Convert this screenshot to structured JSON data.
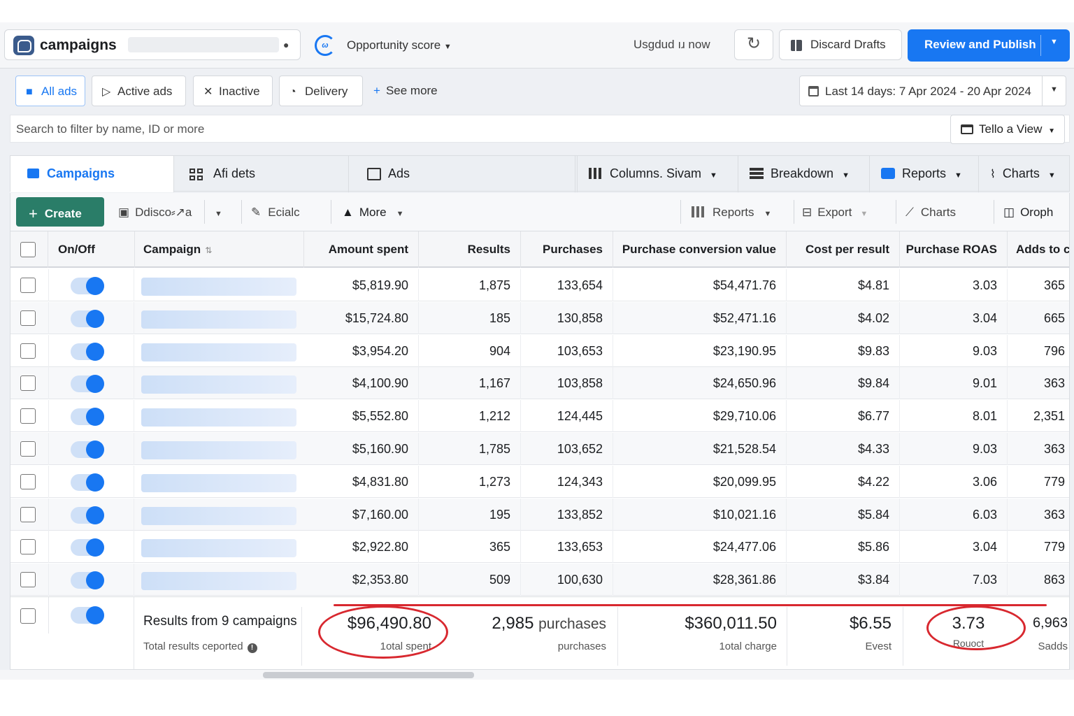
{
  "topbar": {
    "account_name": "campaigns",
    "opportunity_label": "Opportunity score",
    "opportunity_icon_text": "ω",
    "updated_text": "Usgdud ıɹ now",
    "discard_label": "Discard Drafts",
    "publish_label": "Review and Publish"
  },
  "filters": {
    "tabs": [
      {
        "label": "All ads",
        "icon": "folder-icon"
      },
      {
        "label": "Active ads",
        "icon": "play-icon"
      },
      {
        "label": "Inactive",
        "icon": "pin-off-icon"
      },
      {
        "label": "Delivery",
        "icon": "gauge-icon"
      }
    ],
    "see_more": "See more",
    "date_range": "Last 14 days: 7 Apr 2024 - 20 Apr 2024"
  },
  "search": {
    "placeholder": "Search to filter by name, ID or more",
    "save_view": "Tello a View"
  },
  "levels": {
    "campaigns": "Campaigns",
    "adsets": "Afi dets",
    "ads": "Ads",
    "columns": "Columns. Sivam",
    "breakdown": "Breakdown",
    "reports": "Reports",
    "charts": "Charts"
  },
  "actions": {
    "create": "Create",
    "duplicate": "Ddisco⸗↗a",
    "edit": "Ecialc",
    "more": "More",
    "reports": "Reports",
    "export": "Export",
    "charts": "Charts",
    "graph": "Oroph"
  },
  "table": {
    "headers": [
      "On/Off",
      "Campaign",
      "Amount spent",
      "Results",
      "Purchases",
      "Purchase conversion value",
      "Cost per result",
      "Purchase ROAS",
      "Adds to cart"
    ],
    "rows": [
      [
        "$5,819.90",
        "1,875",
        "133,654",
        "$54,471.76",
        "$4.81",
        "3.03",
        "365"
      ],
      [
        "$15,724.80",
        "185",
        "130,858",
        "$52,471.16",
        "$4.02",
        "3.04",
        "665"
      ],
      [
        "$3,954.20",
        "904",
        "103,653",
        "$23,190.95",
        "$9.83",
        "9.03",
        "796"
      ],
      [
        "$4,100.90",
        "1,167",
        "103,858",
        "$24,650.96",
        "$9.84",
        "9.01",
        "363"
      ],
      [
        "$5,552.80",
        "1,212",
        "124,445",
        "$29,710.06",
        "$6.77",
        "8.01",
        "2,351"
      ],
      [
        "$5,160.90",
        "1,785",
        "103,652",
        "$21,528.54",
        "$4.33",
        "9.03",
        "363"
      ],
      [
        "$4,831.80",
        "1,273",
        "124,343",
        "$20,099.95",
        "$4.22",
        "3.06",
        "779"
      ],
      [
        "$7,160.00",
        "195",
        "133,852",
        "$10,021.16",
        "$5.84",
        "6.03",
        "363"
      ],
      [
        "$2,922.80",
        "365",
        "133,653",
        "$24,477.06",
        "$5.86",
        "3.04",
        "779"
      ],
      [
        "$2,353.80",
        "509",
        "100,630",
        "$28,361.86",
        "$3.84",
        "7.03",
        "863"
      ]
    ]
  },
  "summary": {
    "title": "Results from 9 campaigns",
    "subtitle": "Total results ceported",
    "amount": "$96,490.80",
    "amount_label": "1otal spent",
    "purchases_value": "2,985",
    "purchases_unit": "purchases",
    "purchases_label": "purchases",
    "conversion": "$360,011.50",
    "conversion_label": "1otal charge",
    "cost": "$6.55",
    "cost_label": "Evest",
    "roas": "3.73",
    "roas_label": "Rouoct",
    "adds": "6,963",
    "adds_label": "Sadds"
  },
  "colors": {
    "accent": "#1877f2",
    "create": "#2a7d68",
    "annotation": "#d8282f"
  }
}
